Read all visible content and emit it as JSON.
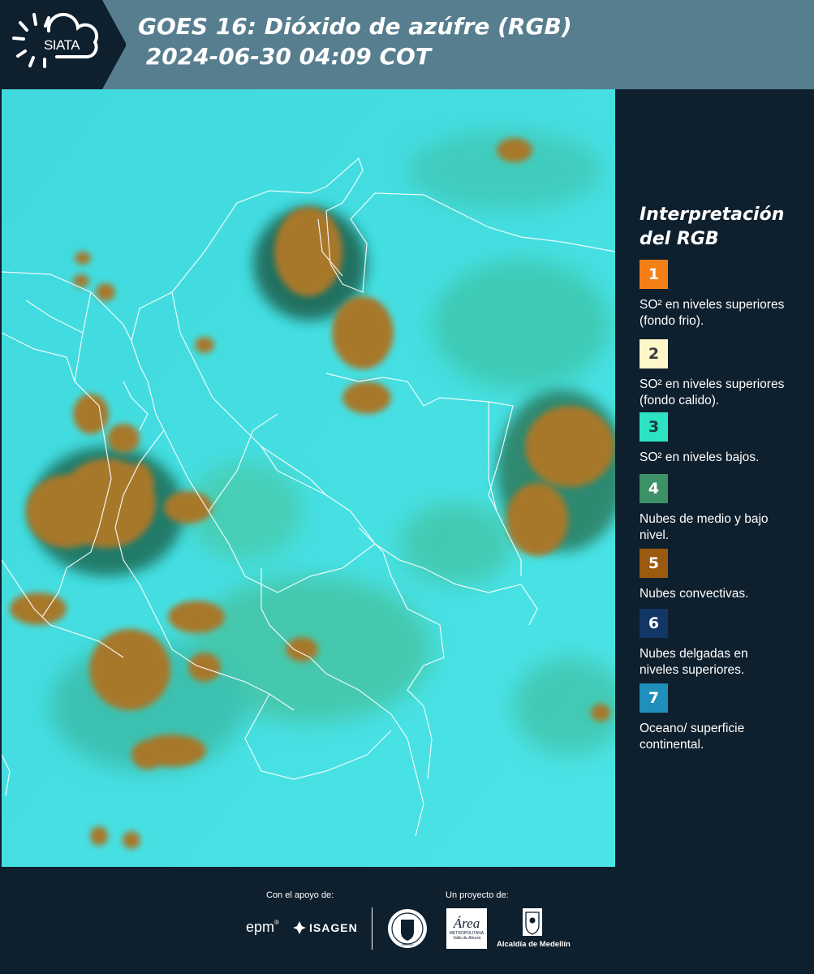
{
  "header": {
    "brand": "SIATA",
    "title_line1": "GOES 16: Dióxido de azúfre (RGB)",
    "title_line2": " 2024-06-30 04:09 COT"
  },
  "legend": {
    "title_line1": "Interpretación",
    "title_line2": "del RGB",
    "items": [
      {
        "number": "1",
        "color": "#f57f17",
        "text_color": "#ffffff",
        "label": "SO² en niveles superiores (fondo frio)."
      },
      {
        "number": "2",
        "color": "#fff7c9",
        "text_color": "#3a3a3a",
        "label": "SO² en niveles superiores (fondo calido)."
      },
      {
        "number": "3",
        "color": "#2de3c4",
        "text_color": "#1a3a3a",
        "label": "SO² en niveles bajos."
      },
      {
        "number": "4",
        "color": "#3d9167",
        "text_color": "#ffffff",
        "label": "Nubes de medio y bajo nivel."
      },
      {
        "number": "5",
        "color": "#9c5a10",
        "text_color": "#ffffff",
        "label": "Nubes convectivas."
      },
      {
        "number": "6",
        "color": "#123766",
        "text_color": "#ffffff",
        "label": "Nubes delgadas en niveles superiores."
      },
      {
        "number": "7",
        "color": "#1f8fbb",
        "text_color": "#ffffff",
        "label": "Oceano/ superficie continental."
      }
    ]
  },
  "footer": {
    "support_label": "Con el apoyo de:",
    "project_label": "Un proyecto de:",
    "sponsor1": "epm",
    "sponsor2": "ISAGEN",
    "partner1_seal": "Medellín",
    "partner2_line1": "Área",
    "partner2_line2": "METROPOLITANA",
    "partner2_line3": "Valle de Aburrá",
    "partner3": "Alcaldía de Medellín"
  }
}
